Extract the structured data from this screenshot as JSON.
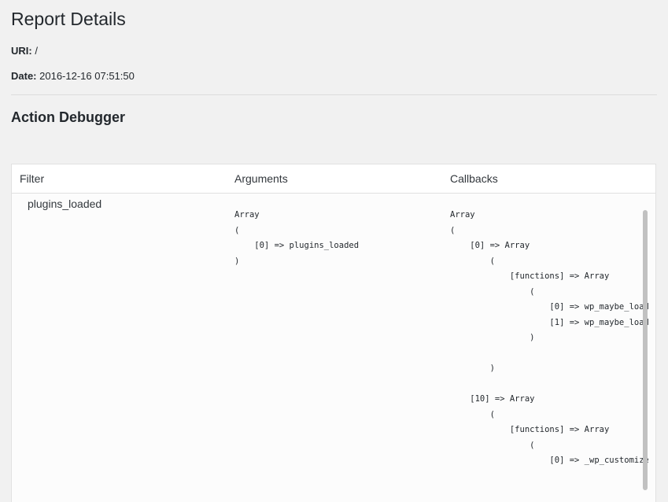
{
  "page": {
    "title": "Report Details",
    "uri_label": "URI:",
    "uri_value": "/",
    "date_label": "Date:",
    "date_value": "2016-12-16 07:51:50",
    "section_title": "Action Debugger"
  },
  "table": {
    "columns": [
      "Filter",
      "Arguments",
      "Callbacks"
    ],
    "rows": [
      {
        "filter": "plugins_loaded",
        "arguments": "Array\n(\n    [0] => plugins_loaded\n)",
        "callbacks": "Array\n(\n    [0] => Array\n        (\n            [functions] => Array\n                (\n                    [0] => wp_maybe_load_widgets\n                    [1] => wp_maybe_load_embeds\n                )\n\n        )\n\n    [10] => Array\n        (\n            [functions] => Array\n                (\n                    [0] => _wp_customize_include\n                )"
      }
    ]
  }
}
